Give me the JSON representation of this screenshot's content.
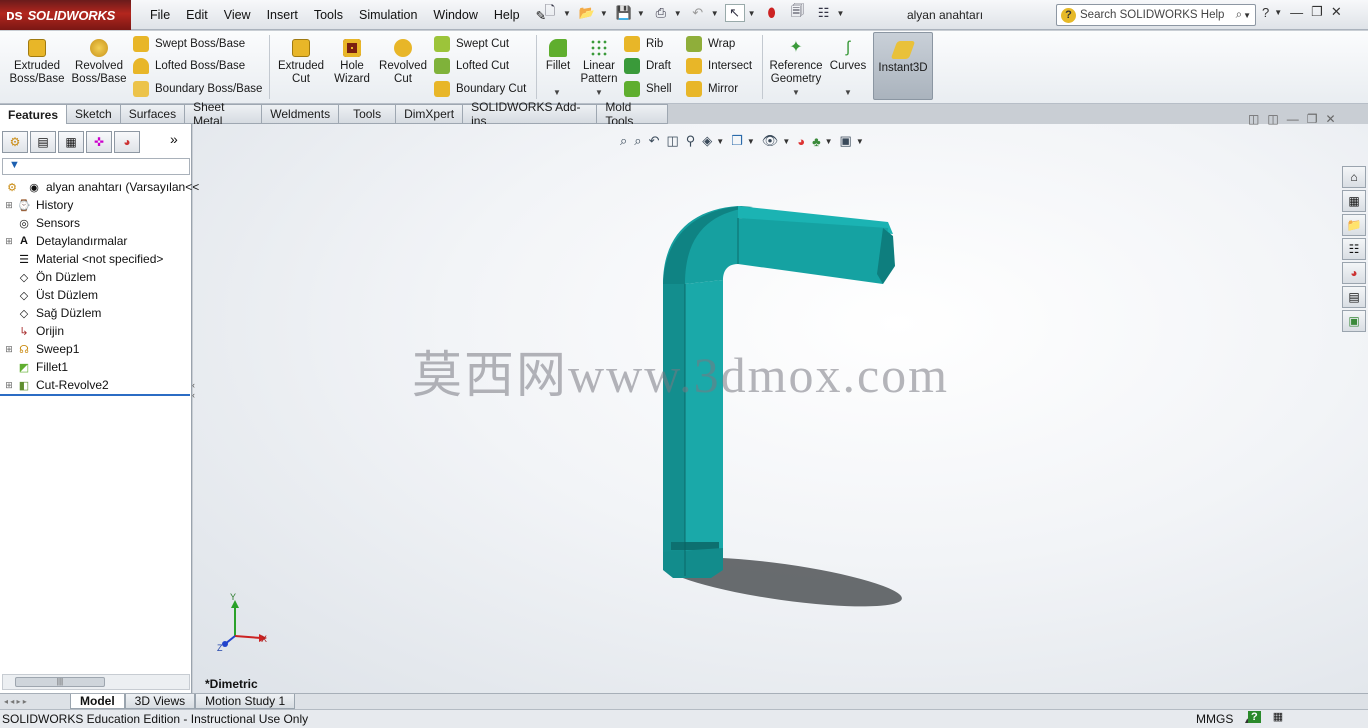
{
  "app": {
    "name": "SOLIDWORKS",
    "document_title": "alyan anahtarı"
  },
  "menu": [
    "File",
    "Edit",
    "View",
    "Insert",
    "Tools",
    "Simulation",
    "Window",
    "Help"
  ],
  "search": {
    "placeholder": "Search SOLIDWORKS Help"
  },
  "ribbon": {
    "extruded_boss": "Extruded Boss/Base",
    "revolved_boss": "Revolved Boss/Base",
    "swept_boss": "Swept Boss/Base",
    "lofted_boss": "Lofted Boss/Base",
    "boundary_boss": "Boundary Boss/Base",
    "extruded_cut": "Extruded Cut",
    "hole_wizard": "Hole Wizard",
    "revolved_cut": "Revolved Cut",
    "swept_cut": "Swept Cut",
    "lofted_cut": "Lofted Cut",
    "boundary_cut": "Boundary Cut",
    "fillet": "Fillet",
    "linear_pattern": "Linear Pattern",
    "rib": "Rib",
    "draft": "Draft",
    "shell": "Shell",
    "wrap": "Wrap",
    "intersect": "Intersect",
    "mirror": "Mirror",
    "reference_geometry": "Reference Geometry",
    "curves": "Curves",
    "instant3d": "Instant3D"
  },
  "tabs": [
    "Features",
    "Sketch",
    "Surfaces",
    "Sheet Metal",
    "Weldments",
    "Tools",
    "DimXpert",
    "SOLIDWORKS Add-ins",
    "Mold Tools"
  ],
  "tree": {
    "root": "alyan anahtarı  (Varsayılan<<",
    "items": [
      "History",
      "Sensors",
      "Detaylandırmalar",
      "Material <not specified>",
      "Ön Düzlem",
      "Üst Düzlem",
      "Sağ Düzlem",
      "Orijin",
      "Sweep1",
      "Fillet1",
      "Cut-Revolve2"
    ]
  },
  "viewport": {
    "view_name": "*Dimetric",
    "watermark": "莫西网www.3dmox.com",
    "axes": {
      "x": "X",
      "y": "Y",
      "z": "Z"
    },
    "model_color": "#17a3a3"
  },
  "bottom_tabs": [
    "Model",
    "3D Views",
    "Motion Study 1"
  ],
  "status": {
    "text": "SOLIDWORKS Education Edition - Instructional Use Only",
    "units": "MMGS"
  },
  "colors": {
    "brand": "#b3261e",
    "accent": "#1d60b0"
  }
}
